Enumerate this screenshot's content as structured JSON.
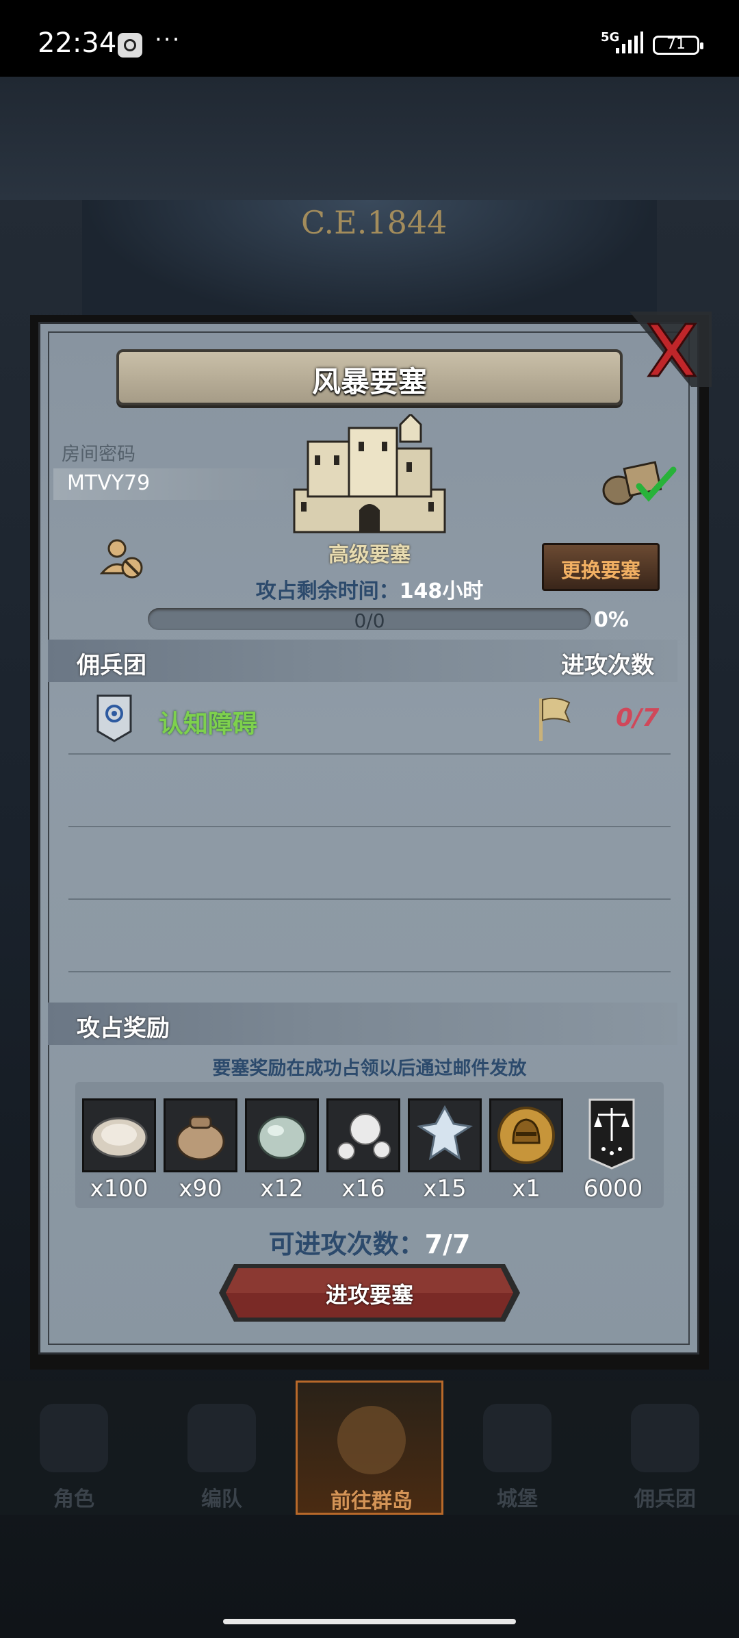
{
  "status_bar": {
    "time": "22:34",
    "dots": "···",
    "network": "5G",
    "battery": "71"
  },
  "background": {
    "era": "C.E.1844"
  },
  "dialog": {
    "title": "风暴要塞",
    "room_password_label": "房间密码",
    "room_password": "MTVY79",
    "fortress_level": "高级要塞",
    "change_button": "更换要塞",
    "time_label": "攻占剩余时间：",
    "time_value": "148",
    "time_unit": "小时",
    "progress_text": "0/0",
    "progress_percent": "0%",
    "progress_fraction": 0,
    "merc_label": "佣兵团",
    "attack_count_label": "进攻次数",
    "guild": {
      "name": "认知障碍",
      "attacks": "0/7"
    },
    "reward_label": "攻占奖励",
    "reward_note": "要塞奖励在成功占领以后通过邮件发放",
    "rewards": [
      {
        "icon": "oyster-icon",
        "qty": "x100"
      },
      {
        "icon": "pouch-icon",
        "qty": "x90"
      },
      {
        "icon": "stone-icon",
        "qty": "x12"
      },
      {
        "icon": "pearls-icon",
        "qty": "x16"
      },
      {
        "icon": "crystal-icon",
        "qty": "x15"
      },
      {
        "icon": "helmet-coin-icon",
        "qty": "x1"
      },
      {
        "icon": "scales-banner-icon",
        "qty": "6000"
      }
    ],
    "attacks_remaining_label": "可进攻次数：",
    "attacks_remaining_value": "7/7",
    "attack_button": "进攻要塞"
  },
  "bottom_nav": [
    {
      "label": "角色",
      "active": false
    },
    {
      "label": "编队",
      "active": false
    },
    {
      "label": "前往群岛",
      "active": true
    },
    {
      "label": "城堡",
      "active": false
    },
    {
      "label": "佣兵团",
      "active": false
    }
  ],
  "colors": {
    "accent_green": "#7ed14d",
    "count_red": "#d0485a",
    "button_orange": "#f2b063"
  }
}
